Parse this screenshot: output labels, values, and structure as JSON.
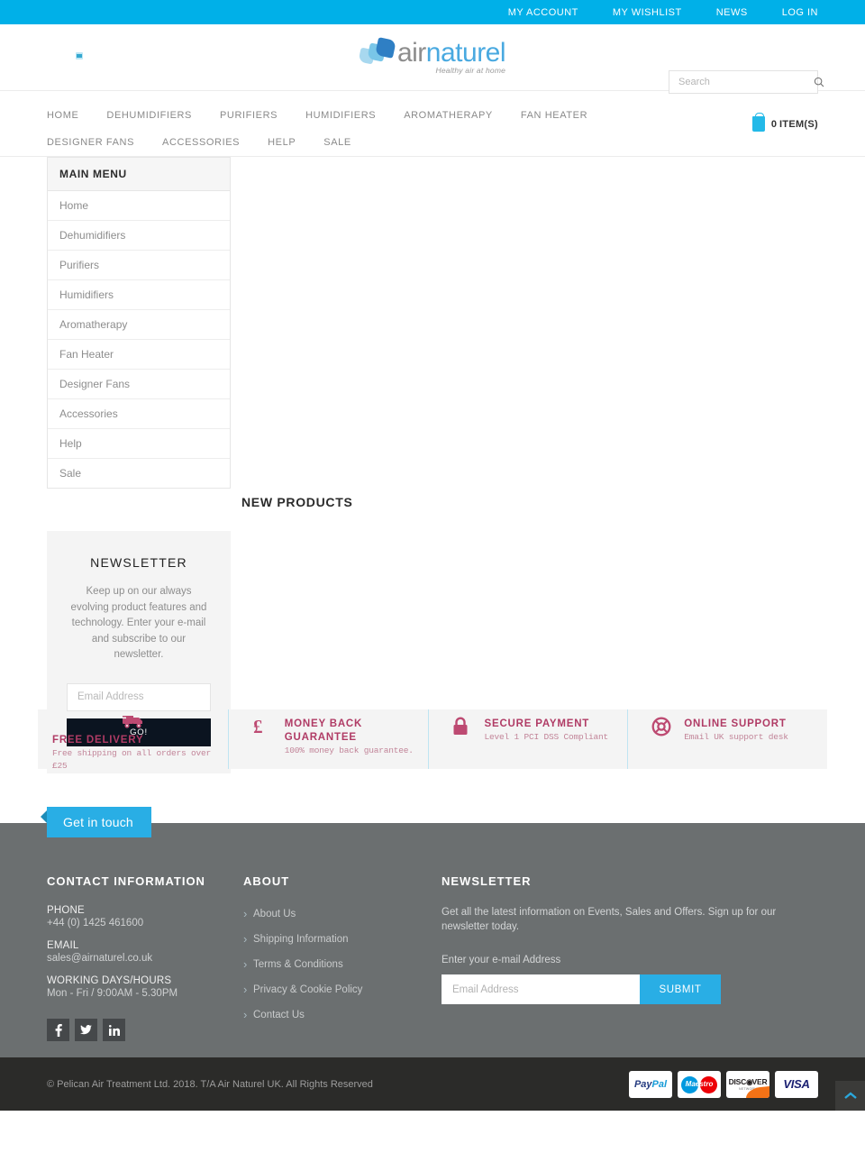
{
  "topbar": {
    "links": [
      {
        "label": "MY ACCOUNT"
      },
      {
        "label": "MY WISHLIST"
      },
      {
        "label": "NEWS"
      },
      {
        "label": "LOG IN"
      }
    ]
  },
  "header": {
    "logo": {
      "word1": "air",
      "word2": "naturel",
      "tagline": "Healthy air at home"
    },
    "search": {
      "placeholder": "Search",
      "value": "",
      "icon": "search-icon"
    }
  },
  "nav": {
    "items": [
      {
        "label": "HOME"
      },
      {
        "label": "DEHUMIDIFIERS"
      },
      {
        "label": "PURIFIERS"
      },
      {
        "label": "HUMIDIFIERS"
      },
      {
        "label": "AROMATHERAPY"
      },
      {
        "label": "FAN HEATER"
      },
      {
        "label": "DESIGNER FANS"
      },
      {
        "label": "ACCESSORIES"
      },
      {
        "label": "HELP"
      },
      {
        "label": "SALE"
      }
    ],
    "cart": {
      "count": "0",
      "label": "ITEM(S)",
      "icon": "shopping-bag-icon"
    }
  },
  "sidebar": {
    "menu_title": "MAIN MENU",
    "items": [
      {
        "label": "Home"
      },
      {
        "label": "Dehumidifiers"
      },
      {
        "label": "Purifiers"
      },
      {
        "label": "Humidifiers"
      },
      {
        "label": "Aromatherapy"
      },
      {
        "label": "Fan Heater"
      },
      {
        "label": "Designer Fans"
      },
      {
        "label": "Accessories"
      },
      {
        "label": "Help"
      },
      {
        "label": "Sale"
      }
    ],
    "newsletter": {
      "title": "NEWSLETTER",
      "text": "Keep up on our always evolving product features and technology. Enter your e-mail and subscribe to our newsletter.",
      "placeholder": "Email Address",
      "value": "",
      "button": "GO!"
    }
  },
  "main": {
    "new_products_title": "NEW PRODUCTS"
  },
  "services": [
    {
      "icon": "delivery-truck-icon",
      "title": "FREE DELIVERY",
      "subtitle": "Free shipping on all orders over £25"
    },
    {
      "icon": "pound-sterling-icon",
      "title": "MONEY BACK GUARANTEE",
      "subtitle": "100% money back guarantee."
    },
    {
      "icon": "lock-icon",
      "title": "SECURE PAYMENT",
      "subtitle": "Level 1 PCI DSS Compliant"
    },
    {
      "icon": "lifebuoy-icon",
      "title": "ONLINE SUPPORT",
      "subtitle": "Email UK support desk"
    }
  ],
  "footer": {
    "get_in_touch": "Get in touch",
    "contact": {
      "title": "CONTACT INFORMATION",
      "phone_label": "PHONE",
      "phone_value": "+44 (0) 1425 461600",
      "email_label": "EMAIL",
      "email_value": "sales@airnaturel.co.uk",
      "hours_label": "WORKING DAYS/HOURS",
      "hours_value": "Mon - Fri / 9:00AM - 5.30PM"
    },
    "social": [
      {
        "name": "facebook-icon",
        "glyph": "f"
      },
      {
        "name": "twitter-icon",
        "glyph": "ᴛ"
      },
      {
        "name": "linkedin-icon",
        "glyph": "in"
      }
    ],
    "about": {
      "title": "ABOUT",
      "links": [
        {
          "label": "About Us"
        },
        {
          "label": "Shipping Information"
        },
        {
          "label": "Terms & Conditions"
        },
        {
          "label": "Privacy & Cookie Policy"
        },
        {
          "label": "Contact Us"
        }
      ]
    },
    "newsletter": {
      "title": "NEWSLETTER",
      "description": "Get all the latest information on Events, Sales and Offers. Sign up for our newsletter today.",
      "sub_label": "Enter your e-mail Address",
      "placeholder": "Email Address",
      "value": "",
      "button": "SUBMIT"
    }
  },
  "bottom": {
    "copyright": "© Pelican Air Treatment Ltd. 2018. T/A Air Naturel UK. All Rights Reserved",
    "cards": [
      {
        "name": "paypal-card-icon",
        "label": "PayPal"
      },
      {
        "name": "maestro-card-icon",
        "label": "Maestro"
      },
      {
        "name": "discover-card-icon",
        "label": "DISC⊙VER",
        "sub": "NETWORK"
      },
      {
        "name": "visa-card-icon",
        "label": "VISA"
      }
    ],
    "scroll_top_icon": "chevron-up-icon"
  },
  "colors": {
    "accent_cyan": "#00b0e8",
    "footer_gray": "#6b6f70",
    "bottom_dark": "#2b2b29",
    "service_magenta": "#b03b65"
  }
}
